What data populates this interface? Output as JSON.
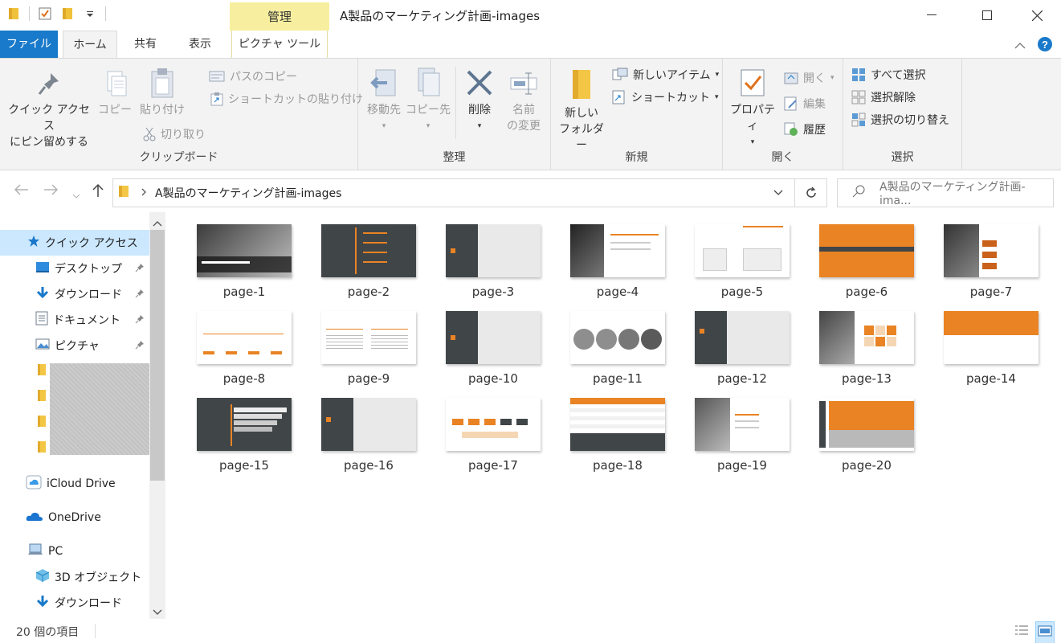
{
  "window": {
    "title": "A製品のマーケティング計画-images",
    "context_tab": "管理",
    "controls": {
      "minimize": "minimize",
      "maximize": "maximize",
      "close": "close"
    }
  },
  "tabs": {
    "file": "ファイル",
    "home": "ホーム",
    "share": "共有",
    "view": "表示",
    "picture_tools": "ピクチャ ツール"
  },
  "ribbon": {
    "clipboard": {
      "label": "クリップボード",
      "pin_line1": "クイック アクセス",
      "pin_line2": "にピン留めする",
      "copy": "コピー",
      "paste": "貼り付け",
      "copy_path": "パスのコピー",
      "paste_shortcut": "ショートカットの貼り付け",
      "cut": "切り取り"
    },
    "organize": {
      "label": "整理",
      "move_to": "移動先",
      "copy_to": "コピー先",
      "delete": "削除",
      "rename_line1": "名前",
      "rename_line2": "の変更"
    },
    "new": {
      "label": "新規",
      "new_folder_line1": "新しい",
      "new_folder_line2": "フォルダー",
      "new_item": "新しいアイテム",
      "shortcut": "ショートカット"
    },
    "open": {
      "label": "開く",
      "properties": "プロパティ",
      "open": "開く",
      "edit": "編集",
      "history": "履歴"
    },
    "select": {
      "label": "選択",
      "select_all": "すべて選択",
      "select_none": "選択解除",
      "invert": "選択の切り替え"
    }
  },
  "address": {
    "path": "A製品のマーケティング計画-images",
    "search_placeholder": "A製品のマーケティング計画-ima..."
  },
  "nav": {
    "quick_access": "クイック アクセス",
    "desktop": "デスクトップ",
    "downloads": "ダウンロード",
    "documents": "ドキュメント",
    "pictures": "ピクチャ",
    "icloud": "iCloud Drive",
    "onedrive": "OneDrive",
    "pc": "PC",
    "objects3d": "3D オブジェクト",
    "pc_downloads": "ダウンロード"
  },
  "files": [
    "page-1",
    "page-2",
    "page-3",
    "page-4",
    "page-5",
    "page-6",
    "page-7",
    "page-8",
    "page-9",
    "page-10",
    "page-11",
    "page-12",
    "page-13",
    "page-14",
    "page-15",
    "page-16",
    "page-17",
    "page-18",
    "page-19",
    "page-20"
  ],
  "status": {
    "item_count": "20 個の項目"
  },
  "colors": {
    "accent": "#1979ca",
    "context_tab": "#f7ef9f",
    "selection": "#cce8ff",
    "slide_orange": "#e98324",
    "slide_dark": "#404548"
  }
}
